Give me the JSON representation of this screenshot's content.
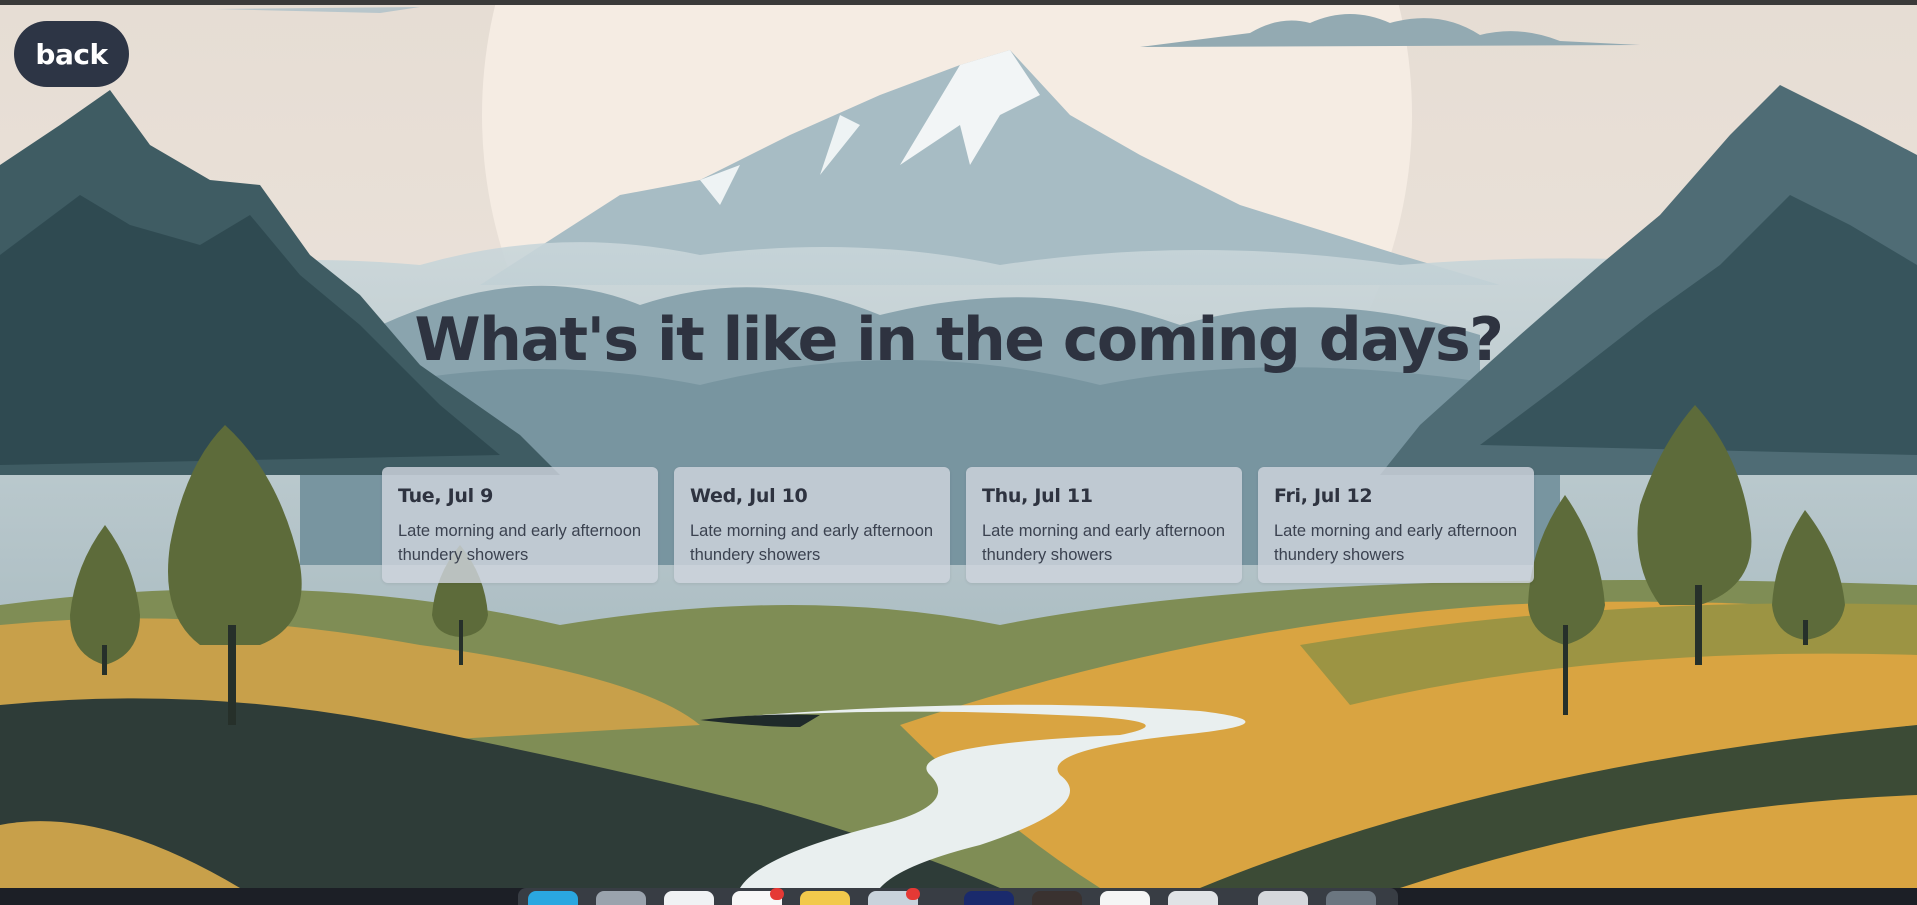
{
  "back_button": {
    "label": "back"
  },
  "headline": "What's it like in the coming days?",
  "forecast": [
    {
      "date": "Tue, Jul 9",
      "description": "Late morning and early afternoon thundery showers"
    },
    {
      "date": "Wed, Jul 10",
      "description": "Late morning and early afternoon thundery showers"
    },
    {
      "date": "Thu, Jul 11",
      "description": "Late morning and early afternoon thundery showers"
    },
    {
      "date": "Fri, Jul 12",
      "description": "Late morning and early afternoon thundery showers"
    }
  ],
  "colors": {
    "sky": "#ece3da",
    "sun": "#f6ede4",
    "mountain_far": "#a9bcc4",
    "mountain_mid": "#6f8e9a",
    "mountain_near": "#2f4a52",
    "field_gold": "#d9a441",
    "field_olive": "#7c8a4c",
    "river": "#e8eeee",
    "text_dark": "#2e3340",
    "back_button_bg": "#2d3545"
  }
}
